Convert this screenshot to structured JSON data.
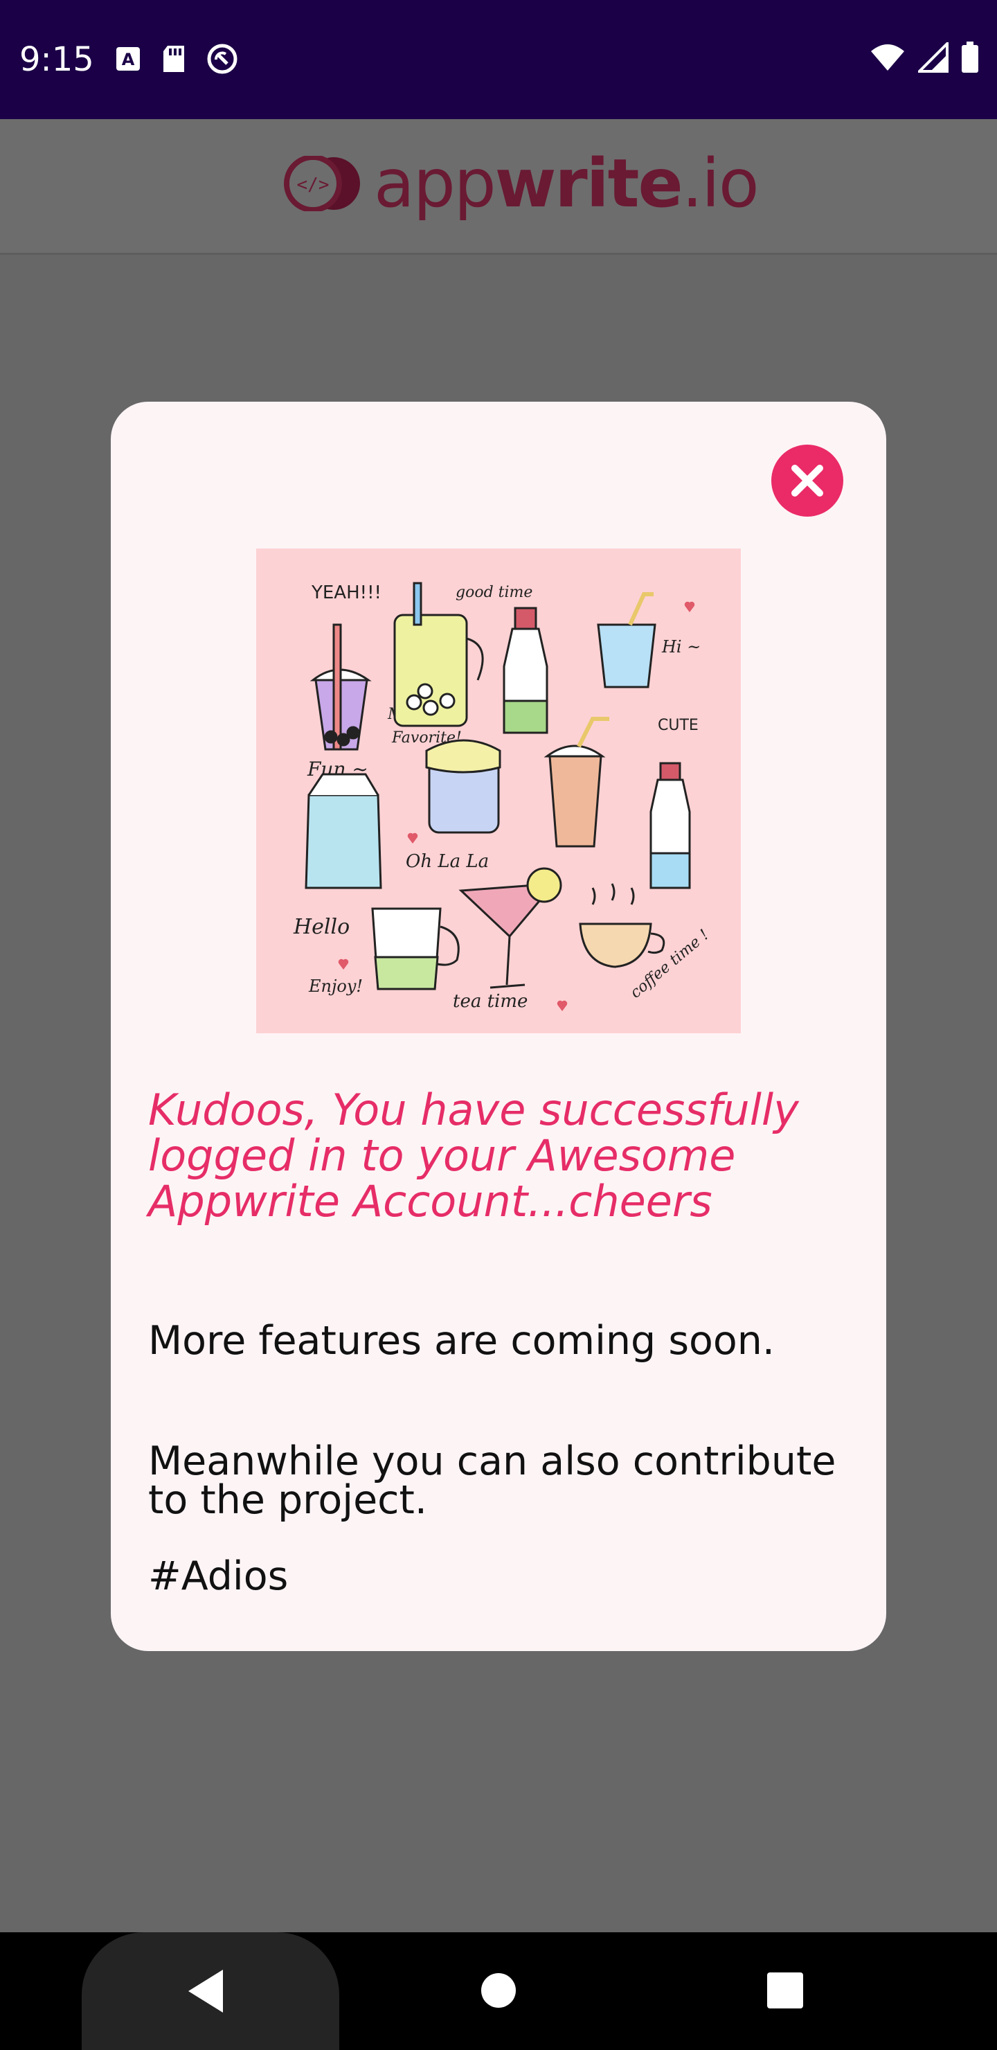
{
  "status_bar": {
    "time": "9:15",
    "left_icons": [
      "a-notification-icon",
      "sd-card-icon",
      "no-sync-icon"
    ],
    "right_icons": [
      "wifi-icon",
      "cell-signal-icon",
      "battery-icon"
    ]
  },
  "header": {
    "logo_part1": "app",
    "logo_part2": "write",
    "logo_part3": ".io",
    "logo_color": "#6a1a33"
  },
  "modal": {
    "close_icon": "close-icon",
    "close_color": "#ea2b67",
    "illustration_icon": "cute-drinks-illustration",
    "illustration_texts": {
      "yeah": "YEAH!!!",
      "good_time": "good time",
      "hi": "Hi ~",
      "my_favorite_1": "My",
      "my_favorite_2": "Favorite!",
      "cute": "CUTE",
      "fun": "Fun ~",
      "oh_la_la": "Oh La La",
      "hello": "Hello",
      "enjoy": "Enjoy!",
      "tea_time": "tea time",
      "coffee_time": "coffee time !"
    },
    "headline": "Kudoos, You have successfully logged in to your Awesome Appwrite Account...cheers",
    "paragraph1": "More features are coming soon.",
    "paragraph2": "Meanwhile you can also contribute to the project.",
    "paragraph3": "#Adios",
    "accent_color": "#e62d67"
  },
  "nav_bar": {
    "back_icon": "back-triangle-icon",
    "home_icon": "home-circle-icon",
    "recents_icon": "recents-square-icon"
  }
}
